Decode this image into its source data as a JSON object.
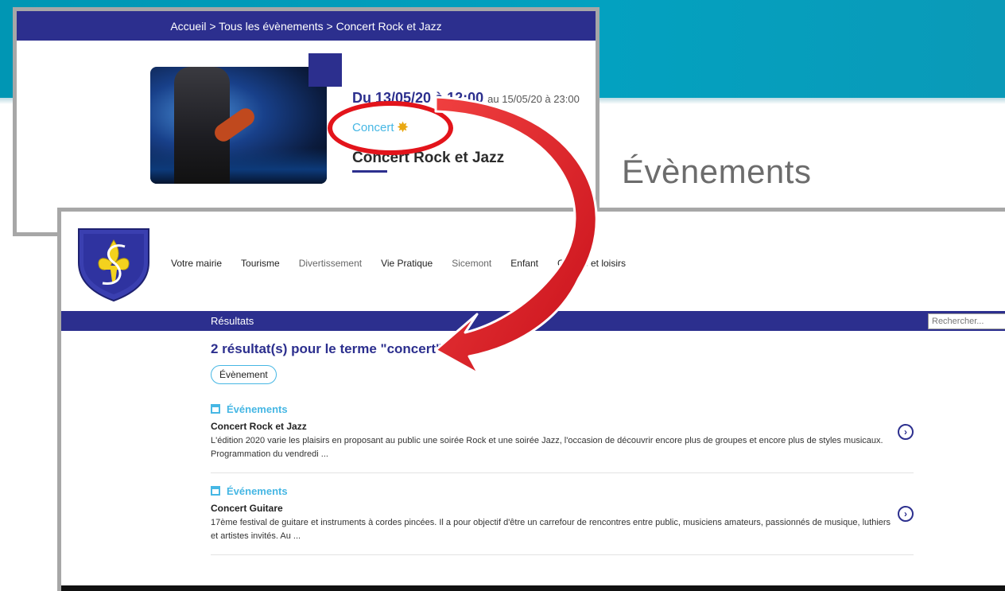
{
  "heading": "Évènements",
  "event_card": {
    "breadcrumb": "Accueil > Tous les évènements > Concert Rock et Jazz",
    "date_from": "Du 13/05/20 à 12:00",
    "date_to": "au 15/05/20 à 23:00",
    "category": "Concert",
    "title": "Concert Rock et Jazz"
  },
  "site": {
    "nav": [
      "Votre mairie",
      "Tourisme",
      "Divertissement",
      "Vie Pratique",
      "Sicemont",
      "Enfant",
      "Culture et loisirs"
    ],
    "results_bar_label": "Résultats",
    "search_placeholder": "Rechercher...",
    "results_heading": "2 résultat(s) pour le terme \"concert\"",
    "filter": "Évènement",
    "results": [
      {
        "category": "Événements",
        "title": "Concert Rock et Jazz",
        "description": "L'édition 2020 varie les plaisirs en proposant au public une soirée Rock et une soirée Jazz, l'occasion de découvrir encore plus de groupes et encore plus de styles musicaux. Programmation du vendredi ..."
      },
      {
        "category": "Événements",
        "title": "Concert Guitare",
        "description": "17ème festival de guitare et instruments à cordes pincées. Il a pour objectif d'être un carrefour de rencontres entre public, musiciens amateurs, passionnés de musique, luthiers et artistes invités. Au ..."
      }
    ]
  },
  "colors": {
    "brand_navy": "#2c2f8e",
    "accent_cyan": "#46b7e4",
    "teal_banner": "#03a1c0",
    "highlight_red": "#e3141b"
  },
  "icons": [
    "fleur-de-lis-shield-icon",
    "calendar-icon",
    "chevron-right-circle-icon",
    "cursor-icon",
    "sparkle-icon"
  ]
}
